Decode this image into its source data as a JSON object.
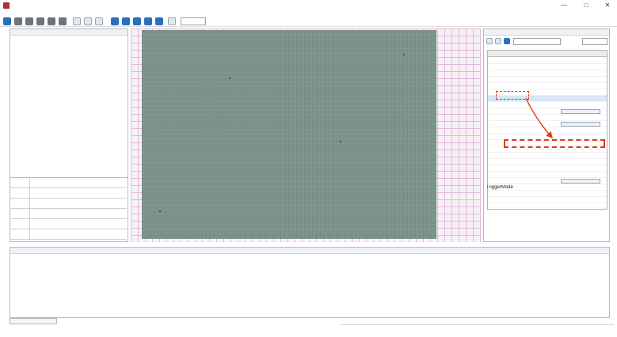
{
  "window": {
    "title": "",
    "controls": [
      "—",
      "□",
      "✕"
    ]
  },
  "toolbar": {
    "zoom_value": "",
    "icons": [
      "connect-icon",
      "refresh-icon",
      "play-icon",
      "stop-icon",
      "record-icon",
      "save-icon",
      "fit-icon",
      "one-to-one-icon",
      "grid-icon",
      "layout-icon",
      "window-icon",
      "panel-icon",
      "settings-icon"
    ]
  },
  "left_panel": {
    "title": "",
    "tree": [
      "",
      "",
      "",
      "",
      "",
      "",
      ""
    ]
  },
  "device_properties": [
    {
      "key": "",
      "value": ""
    },
    {
      "key": "",
      "value": ""
    },
    {
      "key": "",
      "value": ""
    },
    {
      "key": "",
      "value": ""
    },
    {
      "key": "",
      "value": ""
    },
    {
      "key": "",
      "value": ""
    }
  ],
  "right_panel": {
    "title": "",
    "search_placeholder": "",
    "visibility_label": "",
    "visibility_value": "",
    "columns": [
      "",
      ""
    ],
    "features": [
      {
        "name": "",
        "value": ""
      },
      {
        "name": "",
        "value": ""
      },
      {
        "name": "",
        "value": ""
      },
      {
        "name": "",
        "value": ""
      },
      {
        "name": "",
        "value": ""
      },
      {
        "name": "",
        "value": ""
      },
      {
        "name": "",
        "value": ""
      },
      {
        "name": "",
        "value": ""
      },
      {
        "name": "",
        "value": ""
      },
      {
        "name": "",
        "value": ""
      },
      {
        "name": "",
        "value": ""
      },
      {
        "name": "",
        "value": ""
      },
      {
        "name": "",
        "value": ""
      },
      {
        "name": "",
        "value": ""
      },
      {
        "name": "",
        "value": ""
      },
      {
        "name": "",
        "value": ""
      },
      {
        "name": "",
        "value": ""
      },
      {
        "name": "",
        "value": ""
      },
      {
        "name": "",
        "value": ""
      },
      {
        "name": "",
        "value": ""
      },
      {
        "name": "",
        "value": ""
      },
      {
        "name": "",
        "value": ""
      },
      {
        "name": "",
        "value": ""
      },
      {
        "name": "",
        "value": ""
      }
    ],
    "description": {
      "title": "TriggerMode",
      "lines": [
        "",
        "",
        "",
        "",
        "",
        ""
      ]
    }
  },
  "log_panel": {
    "title": "",
    "heading": "",
    "subheading": "",
    "lines": [
      "",
      "",
      "",
      "",
      "",
      "",
      "",
      "",
      "",
      ""
    ]
  },
  "status_bar": {
    "items": [
      "",
      "",
      "",
      "",
      ""
    ]
  },
  "colors": {
    "highlight": "#e23a1a",
    "camera_image": "#7c938b",
    "background_grid": "#e3b9d9"
  }
}
